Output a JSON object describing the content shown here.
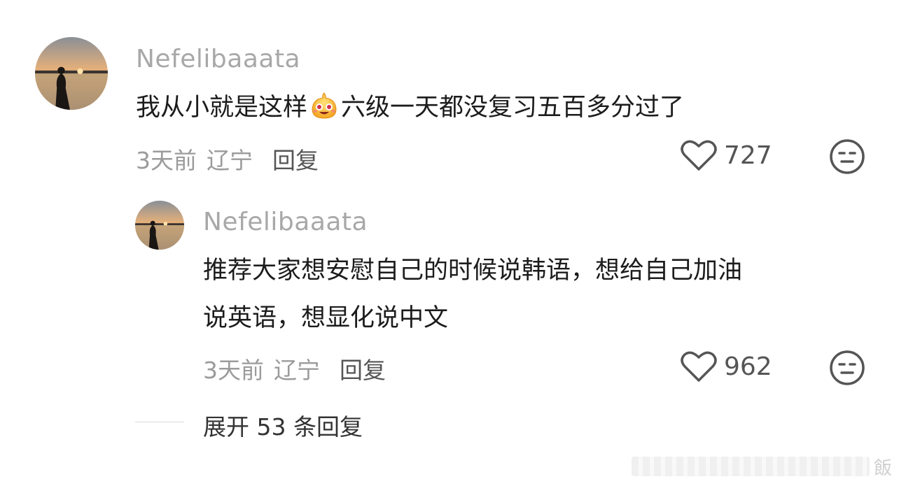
{
  "comments": [
    {
      "username": "Nefelibaaata",
      "text_before": "我从小就是这样",
      "emoji": "smiling-face-emoji",
      "text_after": "六级一天都没复习五百多分过了",
      "time": "3天前",
      "location": "辽宁",
      "reply_label": "回复",
      "likes": "727"
    }
  ],
  "reply": {
    "username": "Nefelibaaata",
    "text_line1": "推荐大家想安慰自己的时候说韩语，想给自己加油",
    "text_line2": "说英语，想显化说中文",
    "time": "3天前",
    "location": "辽宁",
    "reply_label": "回复",
    "likes": "962"
  },
  "expand_label": "展开 53 条回复",
  "watermark_text": "飯",
  "colors": {
    "muted": "#9b9b9b",
    "username": "#a8a8a8",
    "text": "#1c1c1c"
  }
}
